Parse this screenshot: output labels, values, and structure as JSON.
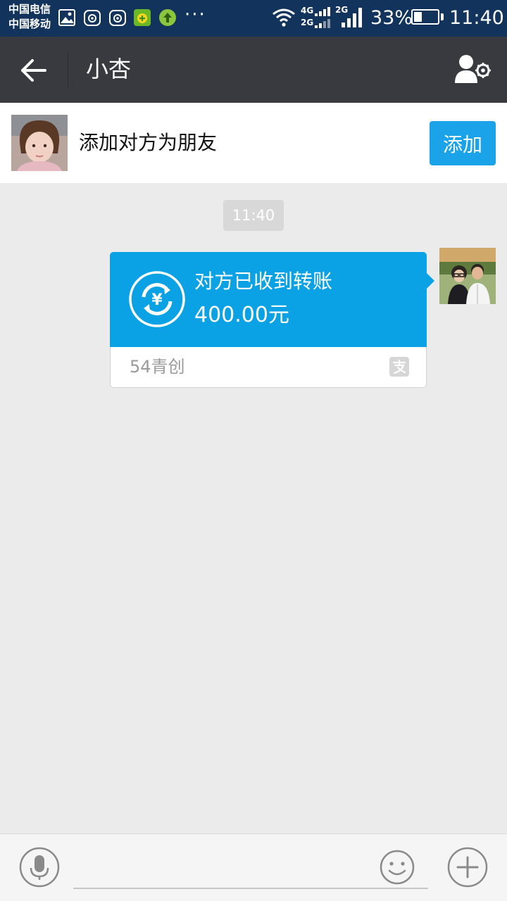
{
  "status_bar": {
    "carrier_1": "中国电信",
    "carrier_2": "中国移动",
    "more": "···",
    "network_4g": "4G",
    "network_2g_left": "2G",
    "network_2g_right": "2G",
    "battery_percent": "33%",
    "battery_level": 0.33,
    "time": "11:40"
  },
  "header": {
    "title": "小杏",
    "back_icon": "arrow-left-icon",
    "settings_icon": "contact-settings-icon"
  },
  "add_friend": {
    "text": "添加对方为朋友",
    "button_label": "添加"
  },
  "chat": {
    "timestamp": "11:40",
    "transfer": {
      "status": "对方已收到转账",
      "amount": "400.00元",
      "source": "54青创",
      "icon": "transfer-received-icon"
    }
  },
  "input_bar": {
    "placeholder": "",
    "voice_icon": "microphone-icon",
    "emoji_icon": "smiley-icon",
    "more_icon": "plus-icon"
  },
  "colors": {
    "status_bar_bg": "#12335b",
    "title_bar_bg": "#393a3f",
    "accent_blue": "#1aa3e8",
    "transfer_blue": "#0aa2e4",
    "chat_bg": "#ebebeb"
  }
}
